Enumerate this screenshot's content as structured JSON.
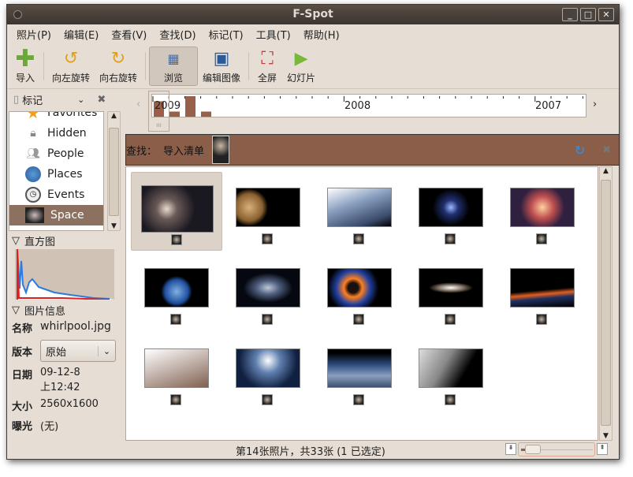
{
  "window": {
    "title": "F-Spot",
    "buttons": [
      "_",
      "□",
      "✕"
    ]
  },
  "menu": [
    "照片(P)",
    "编辑(E)",
    "查看(V)",
    "查找(D)",
    "标记(T)",
    "工具(T)",
    "帮助(H)"
  ],
  "toolbar": {
    "import": "导入",
    "rotate_left": "向左旋转",
    "rotate_right": "向右旋转",
    "browse": "浏览",
    "edit_image": "编辑图像",
    "fullscreen": "全屏",
    "slideshow": "幻灯片"
  },
  "tags": {
    "header": "标记",
    "items": [
      "Favorites",
      "Hidden",
      "People",
      "Places",
      "Events",
      "Space"
    ],
    "selected": "Space"
  },
  "histogram": {
    "label": "直方图"
  },
  "info": {
    "label": "图片信息",
    "name_k": "名称",
    "name_v": "whirlpool.jpg",
    "version_k": "版本",
    "version_v": "原始",
    "date_k": "日期",
    "date_v1": "09-12-8",
    "date_v2": "上12:42",
    "size_k": "大小",
    "size_v": "2560x1600",
    "exposure_k": "曝光",
    "exposure_v": "(无)"
  },
  "timeline": {
    "years": [
      "2009",
      "2008",
      "2007"
    ],
    "bars": [
      3,
      1,
      4,
      1
    ]
  },
  "find": {
    "label": "查找：",
    "term": "导入清单"
  },
  "status": {
    "text": "第14张照片，共33张 (1 已选定)",
    "zoom": 0.1
  },
  "colors": {
    "accent": "#8b5e4a",
    "bar": "#98604a"
  }
}
